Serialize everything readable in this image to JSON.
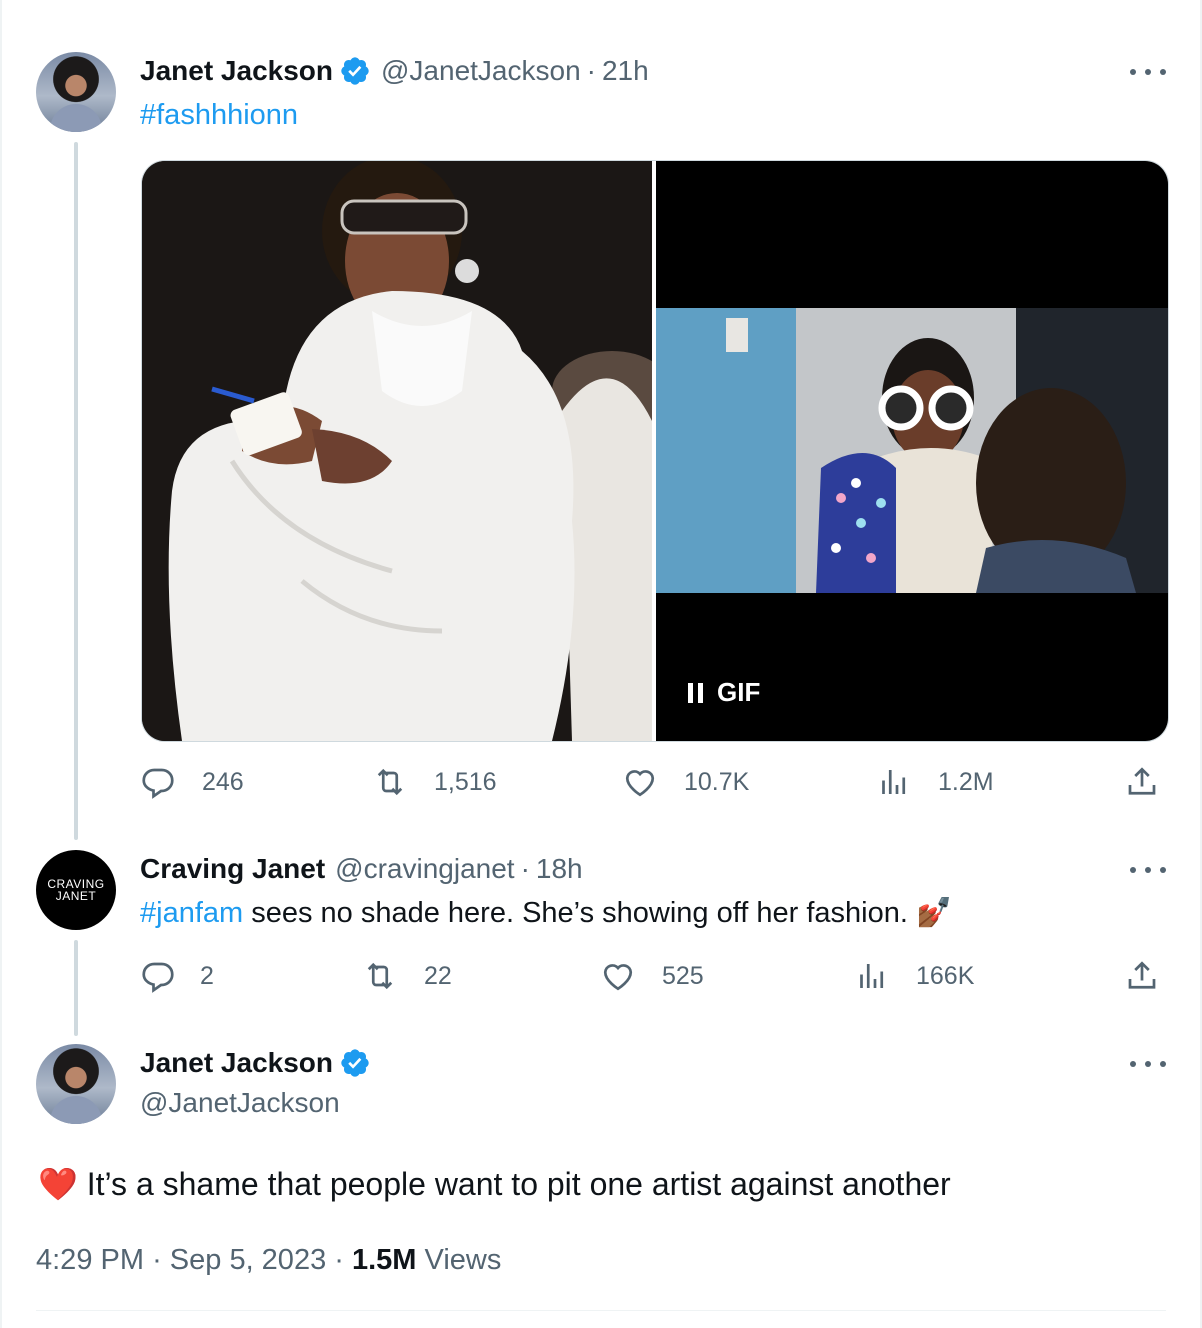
{
  "tweet1": {
    "name": "Janet Jackson",
    "handle": "@JanetJackson",
    "time": "21h",
    "text": "#fashhhionn",
    "gif_label": "GIF",
    "stats": {
      "replies": "246",
      "retweets": "1,516",
      "likes": "10.7K",
      "views": "1.2M"
    }
  },
  "tweet2": {
    "name": "Craving Janet",
    "handle": "@cravingjanet",
    "time": "18h",
    "hashtag": "#janfam",
    "text": " sees no shade here. She’s showing off her fashion. 💅🏾",
    "avatar_line1": "CRAVING",
    "avatar_line2": "JANET",
    "stats": {
      "replies": "2",
      "retweets": "22",
      "likes": "525",
      "views": "166K"
    }
  },
  "tweet3": {
    "name": "Janet Jackson",
    "handle": "@JanetJackson",
    "text": "❤️ It’s a shame that people want to pit one artist against another",
    "time": "4:29 PM",
    "date": "Sep 5, 2023",
    "views_count": "1.5M",
    "views_label": "Views"
  },
  "colors": {
    "accent": "#1d9bf0",
    "muted": "#536471",
    "text": "#0f1419"
  }
}
